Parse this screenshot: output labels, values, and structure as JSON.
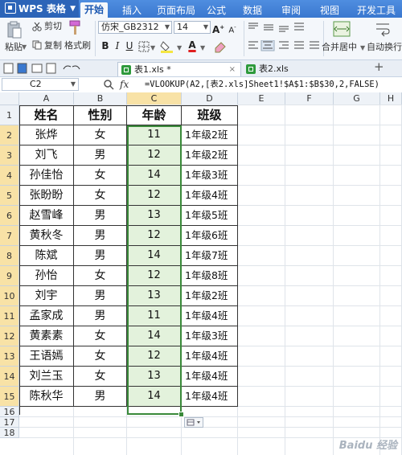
{
  "app": {
    "title": "WPS 表格"
  },
  "ribbon_tabs": [
    "开始",
    "插入",
    "页面布局",
    "公式",
    "数据",
    "审阅",
    "视图",
    "开发工具"
  ],
  "ribbon": {
    "paste": "粘贴",
    "cut": "剪切",
    "copy": "复制",
    "format_painter": "格式刷",
    "font_name": "仿宋_GB2312",
    "font_size": "14",
    "bold": "B",
    "italic": "I",
    "underline": "U",
    "merge_center": "合并居中",
    "auto_wrap": "自动换行",
    "font_color": "#e02020",
    "fill_color": "#f5e642"
  },
  "document_tabs": [
    {
      "label": "表1.xls *",
      "active": true
    },
    {
      "label": "表2.xls",
      "active": false
    }
  ],
  "formula_bar": {
    "cell_ref": "C2",
    "fx": "fx",
    "formula": "=VLOOKUP(A2,[表2.xls]Sheet1!$A$1:$B$30,2,FALSE)"
  },
  "columns": [
    "A",
    "B",
    "C",
    "D",
    "E",
    "F",
    "G",
    "H"
  ],
  "rows": [
    "1",
    "2",
    "3",
    "4",
    "5",
    "6",
    "7",
    "8",
    "9",
    "10",
    "11",
    "12",
    "13",
    "14",
    "15",
    "16",
    "17",
    "18"
  ],
  "table": {
    "headers": [
      "姓名",
      "性别",
      "年龄",
      "班级"
    ],
    "rows": [
      [
        "张烨",
        "女",
        "11",
        "1年级2班"
      ],
      [
        "刘飞",
        "男",
        "12",
        "1年级2班"
      ],
      [
        "孙佳怡",
        "女",
        "14",
        "1年级3班"
      ],
      [
        "张盼盼",
        "女",
        "12",
        "1年级4班"
      ],
      [
        "赵雪峰",
        "男",
        "13",
        "1年级5班"
      ],
      [
        "黄秋冬",
        "男",
        "12",
        "1年级6班"
      ],
      [
        "陈斌",
        "男",
        "14",
        "1年级7班"
      ],
      [
        "孙怡",
        "女",
        "12",
        "1年级8班"
      ],
      [
        "刘宇",
        "男",
        "13",
        "1年级2班"
      ],
      [
        "孟家成",
        "男",
        "11",
        "1年级4班"
      ],
      [
        "黄素素",
        "女",
        "14",
        "1年级3班"
      ],
      [
        "王语嫣",
        "女",
        "12",
        "1年级4班"
      ],
      [
        "刘兰玉",
        "女",
        "13",
        "1年级4班"
      ],
      [
        "陈秋华",
        "男",
        "14",
        "1年级4班"
      ]
    ]
  },
  "watermark": "Baidu 经验",
  "colors": {
    "selection_fill": "#e3f2dc",
    "selection_border": "#3a8a3a",
    "header_highlight": "#f8e2a6",
    "accent": "#3a78cf"
  }
}
